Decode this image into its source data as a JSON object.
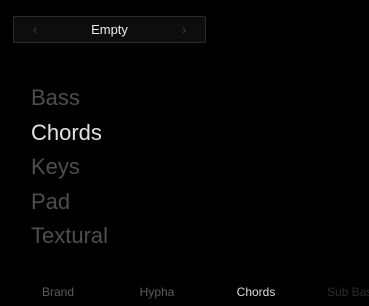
{
  "preset_selector": {
    "value": "Empty",
    "prev_icon": "chevron-left-icon",
    "next_icon": "chevron-right-icon"
  },
  "categories": [
    "Bass",
    "Chords",
    "Keys",
    "Pad",
    "Textural"
  ],
  "selected_category": "Chords",
  "tabs": [
    "Brand",
    "Hypha",
    "Chords",
    "Sub Bass"
  ],
  "active_tab": "Chords",
  "colors": {
    "background": "#000000",
    "selected_text": "#e2e2e2",
    "muted_text": "#4e4e4e"
  }
}
